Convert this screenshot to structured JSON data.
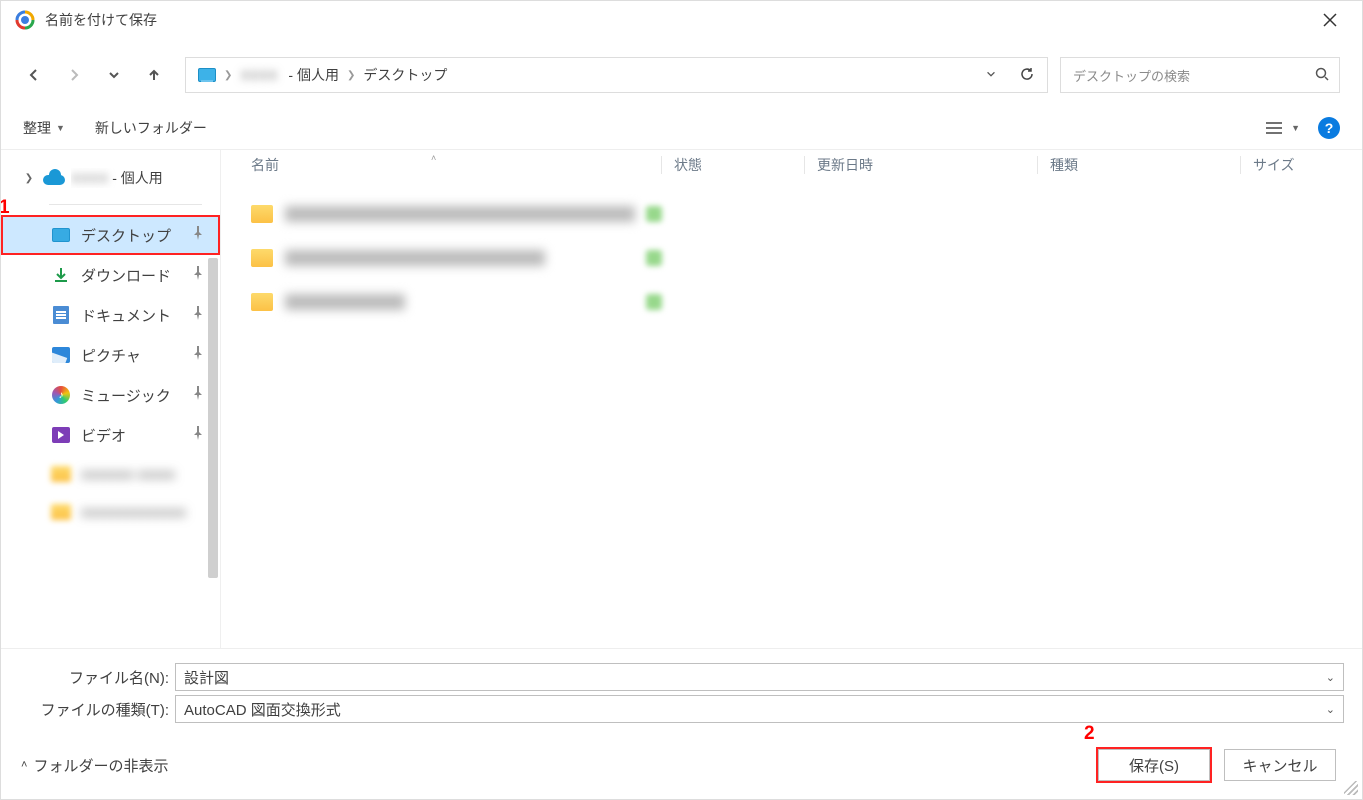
{
  "titlebar": {
    "title": "名前を付けて保存"
  },
  "breadcrumb": {
    "root_hidden": "",
    "personal_suffix": " - 個人用",
    "current": "デスクトップ"
  },
  "search": {
    "placeholder": "デスクトップの検索"
  },
  "toolbar": {
    "organize": "整理",
    "new_folder": "新しいフォルダー"
  },
  "tree": {
    "personal_suffix": " - 個人用"
  },
  "quick_access": [
    {
      "key": "desktop",
      "label": "デスクトップ",
      "icon": "monitor",
      "selected": true
    },
    {
      "key": "downloads",
      "label": "ダウンロード",
      "icon": "download"
    },
    {
      "key": "documents",
      "label": "ドキュメント",
      "icon": "doc"
    },
    {
      "key": "pictures",
      "label": "ピクチャ",
      "icon": "pic"
    },
    {
      "key": "music",
      "label": "ミュージック",
      "icon": "music"
    },
    {
      "key": "videos",
      "label": "ビデオ",
      "icon": "video"
    }
  ],
  "columns": {
    "name": "名前",
    "state": "状態",
    "date": "更新日時",
    "type": "種類",
    "size": "サイズ"
  },
  "rows_blur_widths": [
    {
      "name": 350,
      "date": 130,
      "type": 110
    },
    {
      "name": 260,
      "date": 130,
      "type": 110
    },
    {
      "name": 120,
      "date": 130,
      "type": 110
    }
  ],
  "fields": {
    "filename_label": "ファイル名(N):",
    "filename_value": "設計図",
    "filetype_label": "ファイルの種類(T):",
    "filetype_value": "AutoCAD 図面交換形式"
  },
  "footer": {
    "folder_toggle": "フォルダーの非表示",
    "save": "保存(S)",
    "cancel": "キャンセル"
  },
  "annotations": {
    "one": "1",
    "two": "2"
  }
}
